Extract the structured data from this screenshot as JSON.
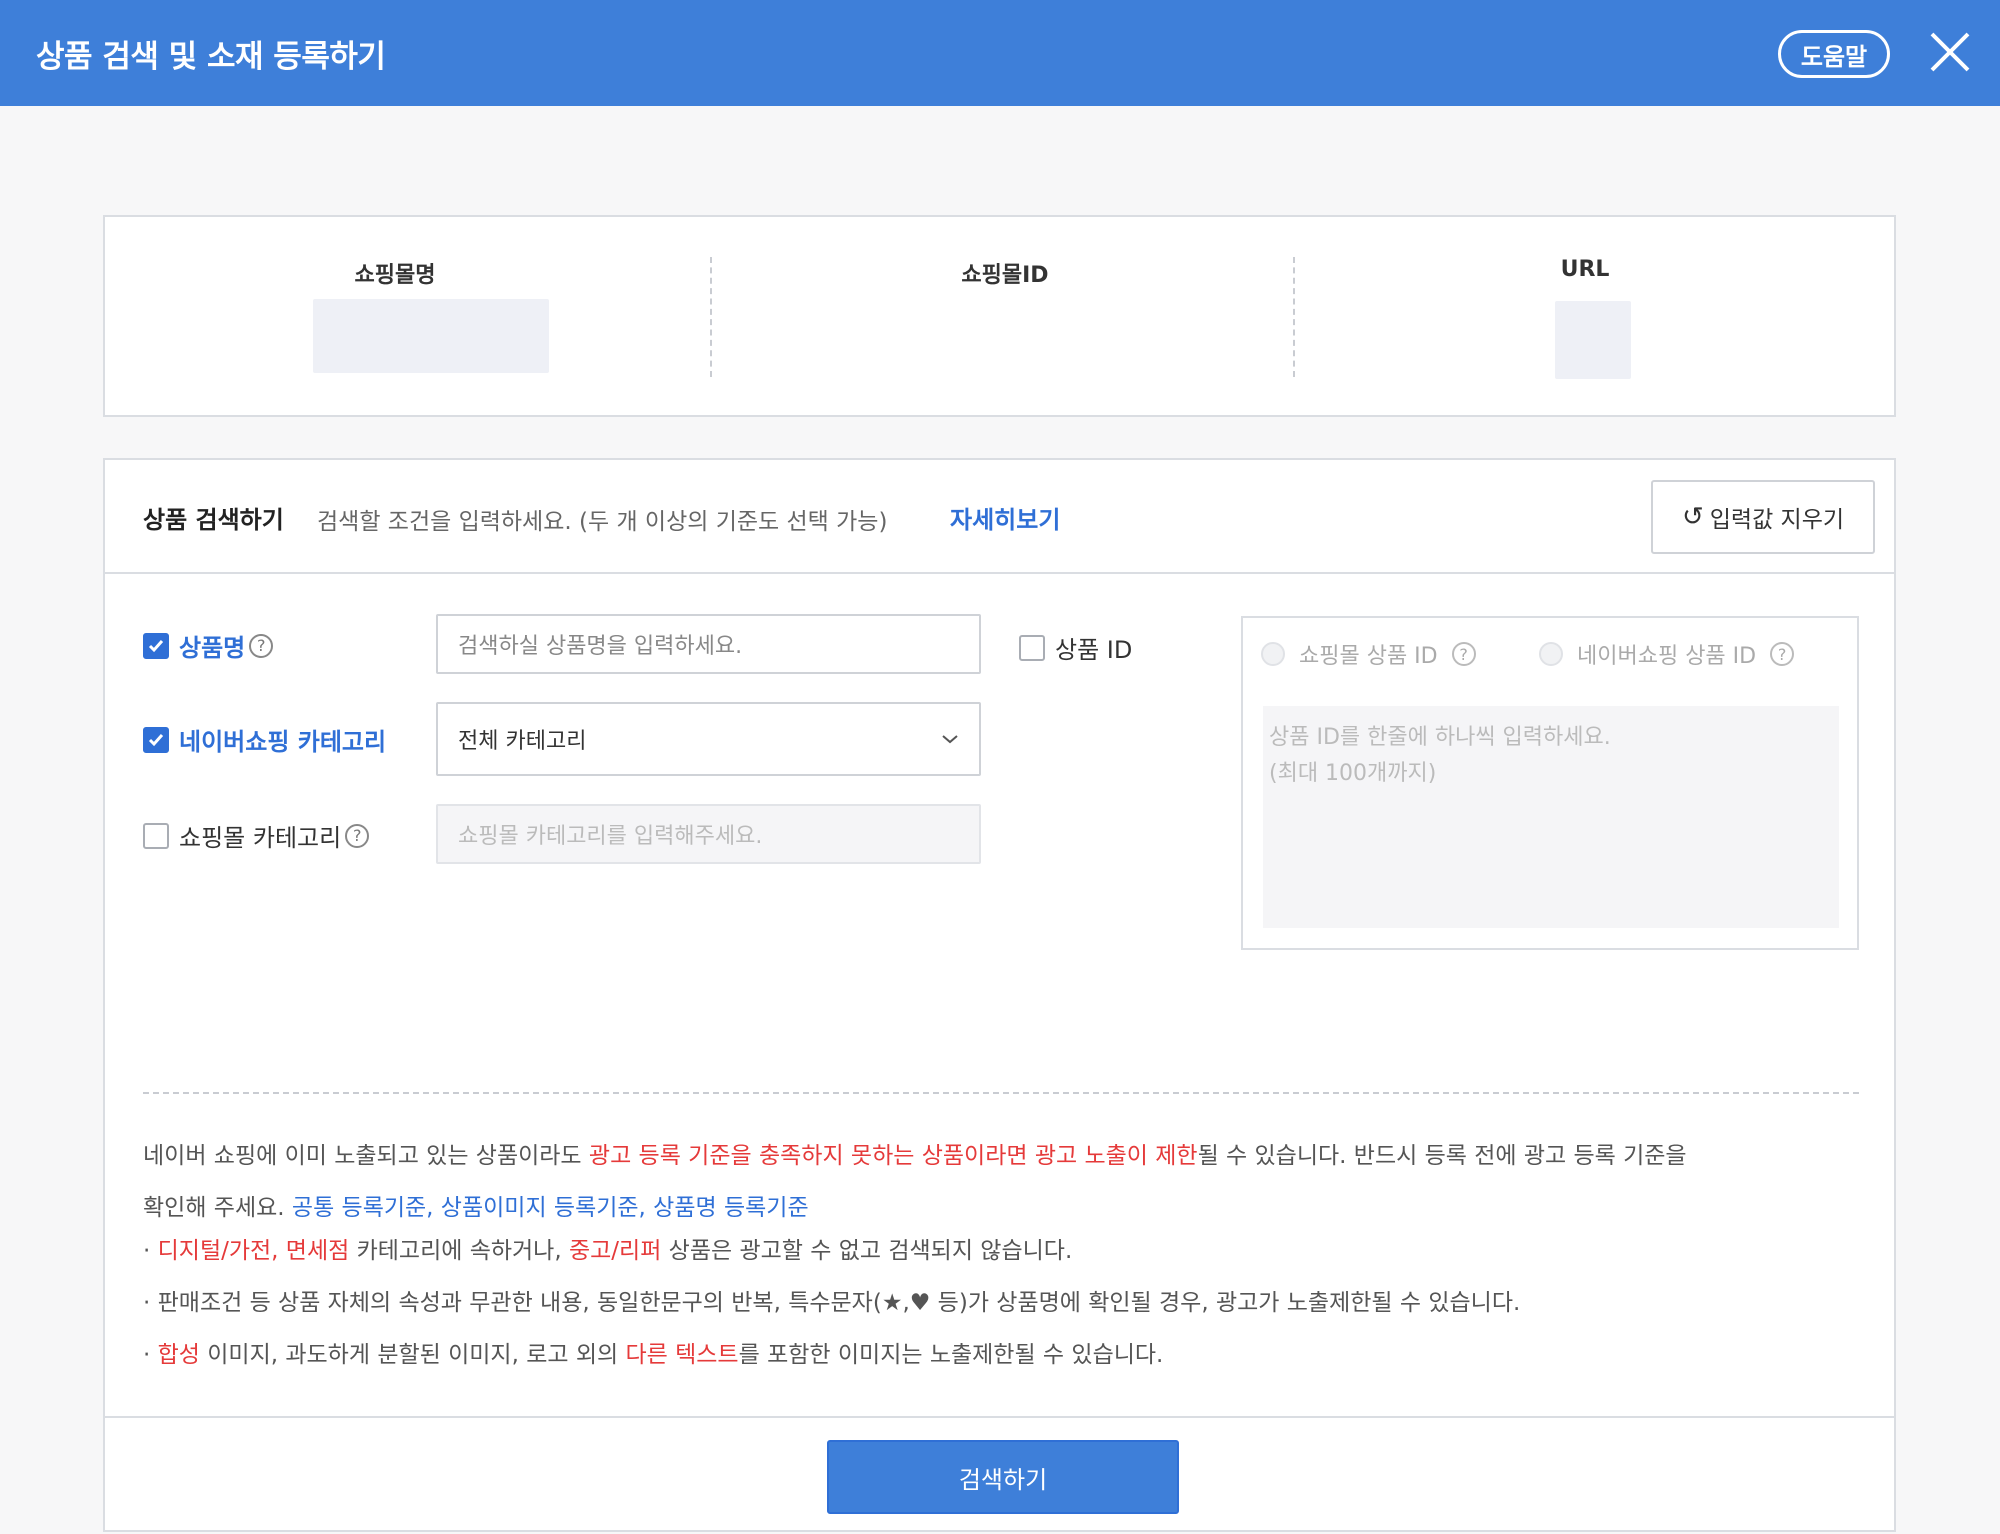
{
  "header": {
    "title": "상품 검색 및 소재 등록하기",
    "help_label": "도움말"
  },
  "info": {
    "columns": [
      "쇼핑몰명",
      "쇼핑몰ID",
      "URL"
    ]
  },
  "search": {
    "title": "상품 검색하기",
    "description": "검색할 조건을 입력하세요. (두 개 이상의 기준도 선택 가능)",
    "detail_link": "자세히보기",
    "reset_label": "입력값 지우기",
    "product_name": {
      "label": "상품명",
      "checked": true,
      "placeholder": "검색하실 상품명을 입력하세요."
    },
    "naver_category": {
      "label": "네이버쇼핑 카테고리",
      "checked": true,
      "selected": "전체 카테고리"
    },
    "mall_category": {
      "label": "쇼핑몰 카테고리",
      "checked": false,
      "placeholder": "쇼핑몰 카테고리를 입력해주세요."
    },
    "product_id": {
      "label": "상품 ID",
      "checked": false,
      "radio_mall": "쇼핑몰 상품 ID",
      "radio_naver": "네이버쇼핑 상품 ID",
      "placeholder_line1": "상품 ID를 한줄에 하나씩 입력하세요.",
      "placeholder_line2": "(최대 100개까지)"
    },
    "question_mark": "?",
    "notice": {
      "p1_a": "네이버 쇼핑에 이미 노출되고 있는 상품이라도 ",
      "p1_red": "광고 등록 기준을 충족하지 못하는 상품이라면 광고 노출이 제한",
      "p1_b": "될 수 있습니다. 반드시 등록 전에 광고 등록 기준을",
      "p1_c": "확인해 주세요. ",
      "p1_links": "공통 등록기준, 상품이미지 등록기준, 상품명 등록기준",
      "bullet": "·",
      "b1_red1": "디지털/가전, 면세점",
      "b1_a": " 카테고리에 속하거나, ",
      "b1_red2": "중고/리퍼",
      "b1_b": " 상품은 광고할 수 없고 검색되지 않습니다.",
      "b2": "판매조건 등 상품 자체의 속성과 무관한 내용, 동일한문구의 반복, 특수문자(★,♥ 등)가 상품명에 확인될 경우, 광고가 노출제한될 수 있습니다.",
      "b3_red1": "합성",
      "b3_a": " 이미지, 과도하게 분할된 이미지, 로고 외의 ",
      "b3_red2": "다른 텍스트",
      "b3_b": "를 포함한 이미지는 노출제한될 수 있습니다."
    },
    "submit_label": "검색하기"
  }
}
